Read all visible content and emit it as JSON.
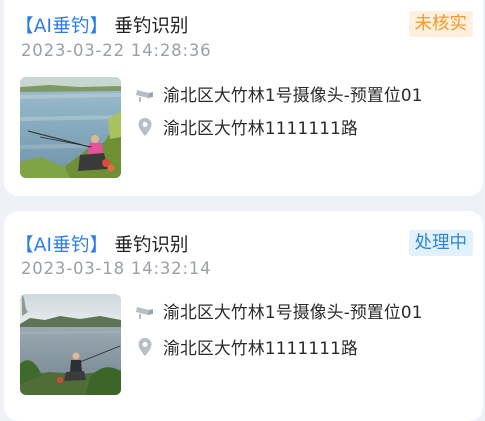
{
  "alerts": [
    {
      "tag": "【AI垂钓】",
      "title": "垂钓识别",
      "status": "未核实",
      "status_color": "#f09a2c",
      "status_bg": "#fdf0de",
      "time": "2023-03-22 14:28:36",
      "camera": "渝北区大竹林1号摄像头-预置位01",
      "address": "渝北区大竹林1111111路",
      "camera_icon": "camera-icon",
      "location_icon": "location-pin-icon"
    },
    {
      "tag": "【AI垂钓】",
      "title": "垂钓识别",
      "status": "处理中",
      "status_color": "#2b88d8",
      "status_bg": "#e2f1fb",
      "time": "2023-03-18 14:32:14",
      "camera": "渝北区大竹林1号摄像头-预置位01",
      "address": "渝北区大竹林1111111路",
      "camera_icon": "camera-icon",
      "location_icon": "location-pin-icon"
    }
  ]
}
